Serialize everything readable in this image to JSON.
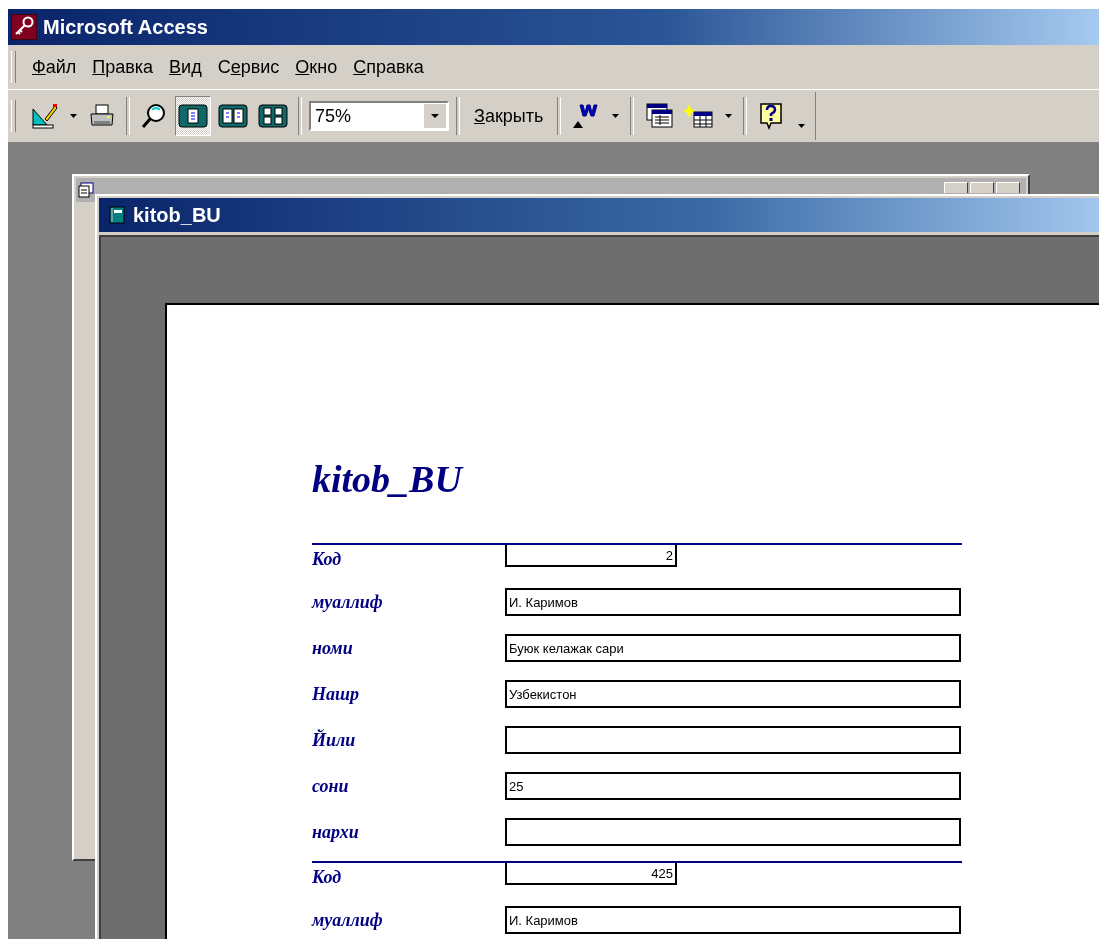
{
  "window": {
    "title": "Microsoft Access"
  },
  "menu": [
    {
      "key": "Ф",
      "rest": "айл"
    },
    {
      "key": "П",
      "rest": "равка"
    },
    {
      "key": "В",
      "rest": "ид"
    },
    {
      "lead": "С",
      "key": "е",
      "rest": "рвис"
    },
    {
      "key": "О",
      "rest": "кно"
    },
    {
      "key": "С",
      "rest": "правка"
    }
  ],
  "toolbar": {
    "view_buttons": [
      {
        "kind": "one",
        "selected": true
      },
      {
        "kind": "two",
        "selected": false
      },
      {
        "kind": "multi",
        "selected": false
      }
    ],
    "zoom": "75%",
    "close_button": {
      "key": "З",
      "rest": "акрыть"
    }
  },
  "report_window": {
    "title": "kitob_BU"
  },
  "report": {
    "title": "kitob_BU",
    "records": [
      {
        "fields": [
          {
            "kind": "code",
            "label": "Код",
            "value": "2"
          },
          {
            "kind": "text",
            "label": "муаллиф",
            "value": "И. Каримов"
          },
          {
            "kind": "text",
            "label": "номи",
            "value": "Буюк келажак сари"
          },
          {
            "kind": "text",
            "label": "Нашр",
            "value": "Узбекистон"
          },
          {
            "kind": "text",
            "label": "Йили"
          },
          {
            "kind": "text",
            "label": "сони",
            "value": "25"
          },
          {
            "kind": "text",
            "label": "нархи"
          }
        ]
      },
      {
        "fields": [
          {
            "kind": "code",
            "label": "Код",
            "value": "425"
          },
          {
            "kind": "text",
            "label": "муаллиф",
            "value": "И. Каримов"
          }
        ]
      }
    ]
  }
}
